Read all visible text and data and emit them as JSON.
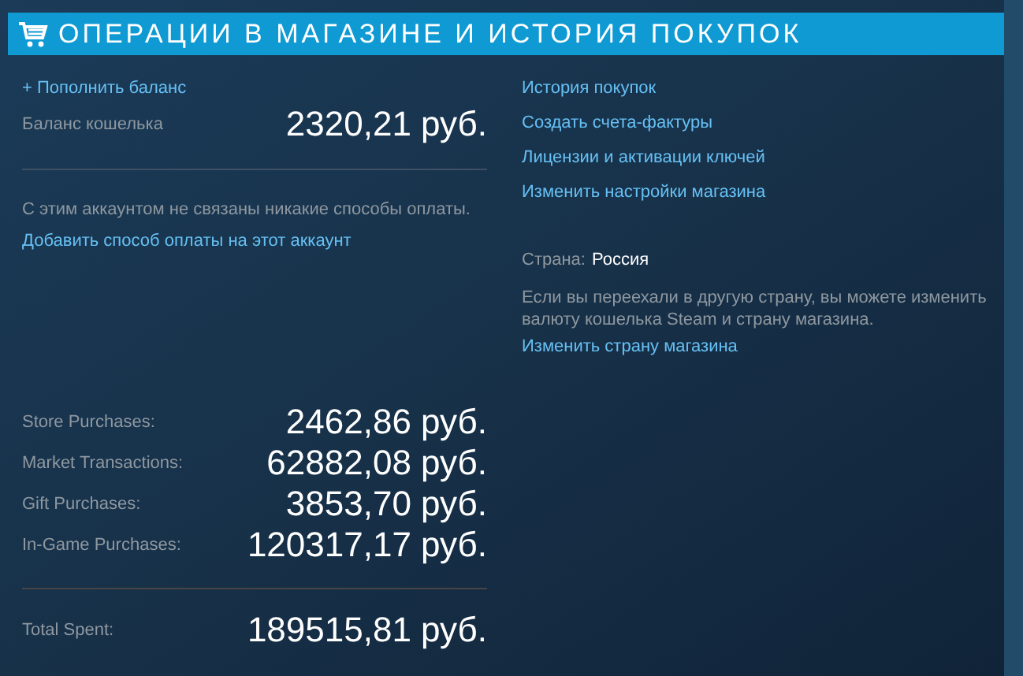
{
  "header": {
    "title": "ОПЕРАЦИИ В МАГАЗИНЕ И ИСТОРИЯ ПОКУПОК"
  },
  "wallet": {
    "add_funds_link": "+ Пополнить баланс",
    "balance_label": "Баланс кошелька",
    "balance": "2320,21 руб."
  },
  "payment": {
    "note": "С этим аккаунтом не связаны никакие способы оплаты.",
    "add_link": "Добавить способ оплаты на этот аккаунт"
  },
  "spending": [
    {
      "label": "Store Purchases:",
      "amount": "2462,86 руб."
    },
    {
      "label": "Market Transactions:",
      "amount": "62882,08 руб."
    },
    {
      "label": "Gift Purchases:",
      "amount": "3853,70 руб."
    },
    {
      "label": "In-Game Purchases:",
      "amount": "120317,17 руб."
    }
  ],
  "total": {
    "label": "Total Spent:",
    "amount": "189515,81 руб."
  },
  "links": [
    "История покупок",
    "Создать счета-фактуры",
    "Лицензии и активации ключей",
    "Изменить настройки магазина"
  ],
  "country": {
    "label": "Страна:",
    "value": "Россия",
    "note": "Если вы переехали в другую страну, вы можете изменить валюту кошелька Steam и страну магазина.",
    "change_link": "Изменить страну магазина"
  }
}
